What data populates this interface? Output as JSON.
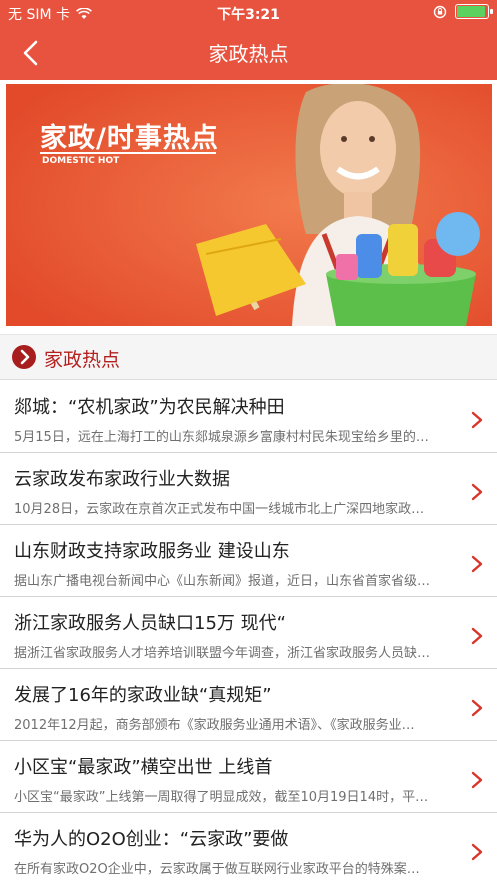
{
  "status_bar": {
    "carrier": "无 SIM 卡",
    "time": "下午3:21",
    "battery_level": 0.95
  },
  "nav": {
    "title": "家政热点",
    "back_icon": "chevron-left-icon"
  },
  "banner": {
    "title": "家政/时事热点",
    "subtitle": "DOMESTIC HOT"
  },
  "section": {
    "label": "家政热点"
  },
  "colors": {
    "header": "#e8533f",
    "accent": "#b3201e",
    "arrow": "#d9342b"
  },
  "news": [
    {
      "headline": "郯城：“农机家政”为农民解决种田",
      "summary": "5月15日，远在上海打工的山东郯城泉源乡富康村村民朱现宝给乡里的…"
    },
    {
      "headline": "云家政发布家政行业大数据",
      "summary": "10月28日，云家政在京首次正式发布中国一线城市北上广深四地家政…"
    },
    {
      "headline": "山东财政支持家政服务业 建设山东",
      "summary": "据山东广播电视台新闻中心《山东新闻》报道，近日，山东省首家省级…"
    },
    {
      "headline": "浙江家政服务人员缺口15万 现代“",
      "summary": "据浙江省家政服务人才培养培训联盟今年调查，浙江省家政服务人员缺…"
    },
    {
      "headline": "发展了16年的家政业缺“真规矩”",
      "summary": "2012年12月起，商务部颁布《家政服务业通用术语》、《家政服务业…"
    },
    {
      "headline": "小区宝“最家政”横空出世 上线首",
      "summary": "小区宝“最家政”上线第一周取得了明显成效，截至10月19日14时，平…"
    },
    {
      "headline": "华为人的O2O创业：“云家政”要做",
      "summary": "在所有家政O2O企业中，云家政属于做互联网行业家政平台的特殊案…"
    }
  ]
}
